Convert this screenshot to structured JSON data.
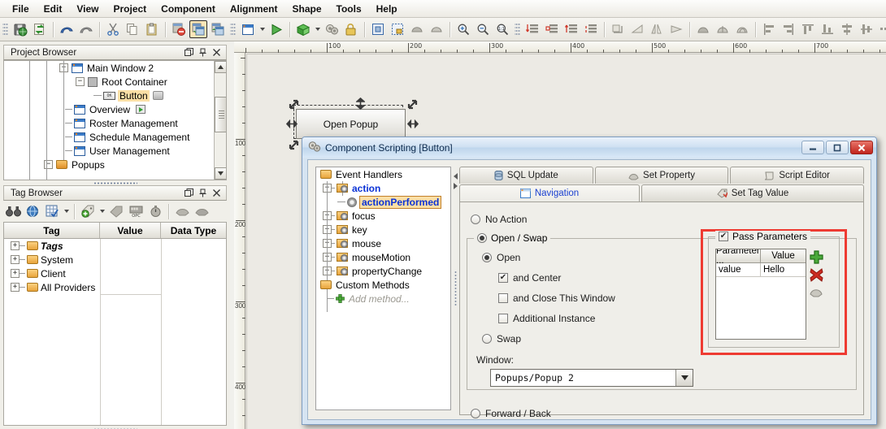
{
  "app": {
    "menus": [
      "File",
      "Edit",
      "View",
      "Project",
      "Component",
      "Alignment",
      "Shape",
      "Tools",
      "Help"
    ]
  },
  "toolbar": {
    "groups": [
      {
        "icons": [
          "save-icon",
          "refresh-icon"
        ]
      },
      {
        "icons": [
          "undo-icon",
          "redo-icon"
        ]
      },
      {
        "icons": [
          "cut-icon",
          "copy-icon",
          "paste-icon"
        ]
      },
      {
        "icons": [
          "delete-window-icon",
          "copy-window-icon",
          "paste-window-icon"
        ]
      },
      {
        "icons": [
          "new-window-icon",
          "new-window-dropdown",
          "preview-icon"
        ]
      },
      {
        "icons": [
          "publish-icon",
          "publish-dropdown",
          "settings-icon",
          "security-icon"
        ]
      },
      {
        "icons": [
          "select-all-icon",
          "select-region-icon",
          "shape-a-icon",
          "shape-b-icon"
        ]
      },
      {
        "icons": [
          "zoom-in-icon",
          "zoom-out-icon",
          "zoom-reset-icon"
        ]
      },
      {
        "icons": [
          "order-front-icon",
          "order-left-icon",
          "order-right-icon",
          "order-back-icon"
        ]
      },
      {
        "icons": [
          "rotate-icon",
          "mirror-icon",
          "flip-h-icon",
          "flip-v-icon"
        ]
      },
      {
        "icons": [
          "union-icon",
          "intersect-icon",
          "subtract-icon"
        ]
      },
      {
        "icons": [
          "align-left-icon",
          "align-right-icon",
          "align-top-icon",
          "align-bottom-icon",
          "align-center-h-icon",
          "align-center-v-icon",
          "distribute-icon",
          "distribute-dropdown"
        ]
      },
      {
        "icons": [
          "space-v-icon",
          "space-v-dropdown",
          "size-width-icon",
          "size-height-icon"
        ]
      }
    ]
  },
  "project_browser": {
    "title": "Project Browser",
    "titlebar_buttons": [
      "float-icon",
      "pin-icon",
      "close-icon"
    ],
    "nodes": [
      {
        "label": "Main Window 2",
        "icon": "window-icon",
        "indent": 3,
        "expander": "-",
        "selected": false
      },
      {
        "label": "Root Container",
        "icon": "container-icon",
        "indent": 4,
        "expander": "-",
        "selected": false
      },
      {
        "label": "Button",
        "icon": "button-icon",
        "indent": 5,
        "expander": "",
        "selected": true,
        "trailing_icon": "scroll-icon"
      },
      {
        "label": "Overview",
        "icon": "window-icon",
        "indent": 3,
        "expander": "",
        "selected": false,
        "trailing_icon": "start-flag-icon"
      },
      {
        "label": "Roster Management",
        "icon": "window-icon",
        "indent": 3,
        "expander": "",
        "selected": false
      },
      {
        "label": "Schedule Management",
        "icon": "window-icon",
        "indent": 3,
        "expander": "",
        "selected": false
      },
      {
        "label": "User Management",
        "icon": "window-icon",
        "indent": 3,
        "expander": "",
        "selected": false
      },
      {
        "label": "Popups",
        "icon": "folder-icon",
        "indent": 2,
        "expander": "-",
        "selected": false
      }
    ]
  },
  "tag_browser": {
    "title": "Tag Browser",
    "titlebar_buttons": [
      "float-icon",
      "pin-icon",
      "close-icon"
    ],
    "toolbar_icons": [
      "binoculars-icon",
      "tag-browse-icon",
      "tag-grid-icon",
      "browse-dropdown",
      "new-tag-icon",
      "new-tag-dropdown",
      "tag-edit-icon",
      "opc-icon",
      "timer-icon",
      "import-icon",
      "export-icon"
    ],
    "columns": [
      "Tag",
      "Value",
      "Data Type"
    ],
    "rows": [
      {
        "tag": "Tags",
        "value": "",
        "type": "",
        "icon": "tags-root-icon",
        "italic": true
      },
      {
        "tag": "System",
        "value": "",
        "type": "",
        "icon": "folder-icon",
        "italic": false
      },
      {
        "tag": "Client",
        "value": "",
        "type": "",
        "icon": "folder-icon",
        "italic": false
      },
      {
        "tag": "All Providers",
        "value": "",
        "type": "",
        "icon": "folder-icon",
        "italic": false
      }
    ]
  },
  "canvas": {
    "ruler_h_labels": [
      "100",
      "200",
      "300",
      "400",
      "500",
      "600",
      "700"
    ],
    "ruler_v_labels": [
      "100",
      "200",
      "300",
      "400"
    ],
    "selected_component": {
      "label": "Open Popup"
    }
  },
  "dialog": {
    "title": "Component Scripting [Button]",
    "title_icon": "gears-icon",
    "window_buttons": [
      "minimize-icon",
      "maximize-icon",
      "close-icon"
    ],
    "event_tree": [
      {
        "label": "Event Handlers",
        "icon": "folder-icon",
        "indent": 0,
        "expander": "",
        "style": "plain"
      },
      {
        "label": "action",
        "icon": "folder-gear-icon",
        "indent": 1,
        "expander": "-",
        "style": "link-bold"
      },
      {
        "label": "actionPerformed",
        "icon": "gear-icon",
        "indent": 2,
        "expander": "",
        "style": "selected-bold"
      },
      {
        "label": "focus",
        "icon": "folder-gear-icon",
        "indent": 1,
        "expander": "+",
        "style": "plain"
      },
      {
        "label": "key",
        "icon": "folder-gear-icon",
        "indent": 1,
        "expander": "+",
        "style": "plain"
      },
      {
        "label": "mouse",
        "icon": "folder-gear-icon",
        "indent": 1,
        "expander": "+",
        "style": "plain"
      },
      {
        "label": "mouseMotion",
        "icon": "folder-gear-icon",
        "indent": 1,
        "expander": "+",
        "style": "plain"
      },
      {
        "label": "propertyChange",
        "icon": "folder-gear-icon",
        "indent": 1,
        "expander": "+",
        "style": "plain"
      },
      {
        "label": "Custom Methods",
        "icon": "folder-icon",
        "indent": 0,
        "expander": "",
        "style": "plain"
      },
      {
        "label": "Add method...",
        "icon": "plus-icon",
        "indent": 1,
        "expander": "",
        "style": "ghost-italic"
      }
    ],
    "tabs_row1": [
      {
        "label": "SQL Update",
        "icon": "database-icon",
        "active": false
      },
      {
        "label": "Set Property",
        "icon": "property-icon",
        "active": false
      },
      {
        "label": "Script Editor",
        "icon": "script-icon",
        "active": false
      }
    ],
    "tabs_row2": [
      {
        "label": "Navigation",
        "icon": "navigation-icon",
        "active": true
      },
      {
        "label": "Set Tag Value",
        "icon": "tag-value-icon",
        "active": false
      }
    ],
    "navigation": {
      "no_action": {
        "label": "No Action",
        "selected": false
      },
      "open_swap": {
        "label": "Open / Swap",
        "selected": true
      },
      "open": {
        "label": "Open",
        "selected": true
      },
      "and_center": {
        "label": "and Center",
        "checked": true
      },
      "and_close": {
        "label": "and Close This Window",
        "checked": false
      },
      "additional_instance": {
        "label": "Additional Instance",
        "checked": false
      },
      "swap": {
        "label": "Swap",
        "selected": false
      },
      "window_label": "Window:",
      "window_value": "Popups/Popup 2",
      "forward_back": {
        "label": "Forward / Back",
        "selected": false
      }
    },
    "pass_parameters": {
      "label": "Pass Parameters",
      "checked": true,
      "columns": [
        "Parameter ...",
        "Value"
      ],
      "rows": [
        {
          "parameter": "value",
          "value": "Hello"
        }
      ],
      "side_buttons": [
        "add-parameter-icon",
        "remove-parameter-icon",
        "edit-parameter-icon"
      ],
      "highlight_color": "#ee3b32"
    }
  }
}
